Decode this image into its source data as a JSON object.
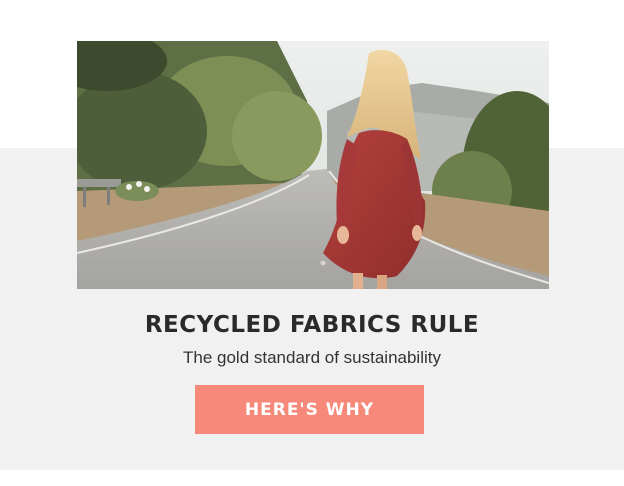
{
  "promo": {
    "headline": "RECYCLED FABRICS RULE",
    "subheadline": "The gold standard of sustainability",
    "cta_label": "HERE'S WHY"
  },
  "colors": {
    "band": "#f1f1f1",
    "cta_background": "#f6897a",
    "cta_text": "#ffffff",
    "headline_text": "#2a2a2a"
  }
}
